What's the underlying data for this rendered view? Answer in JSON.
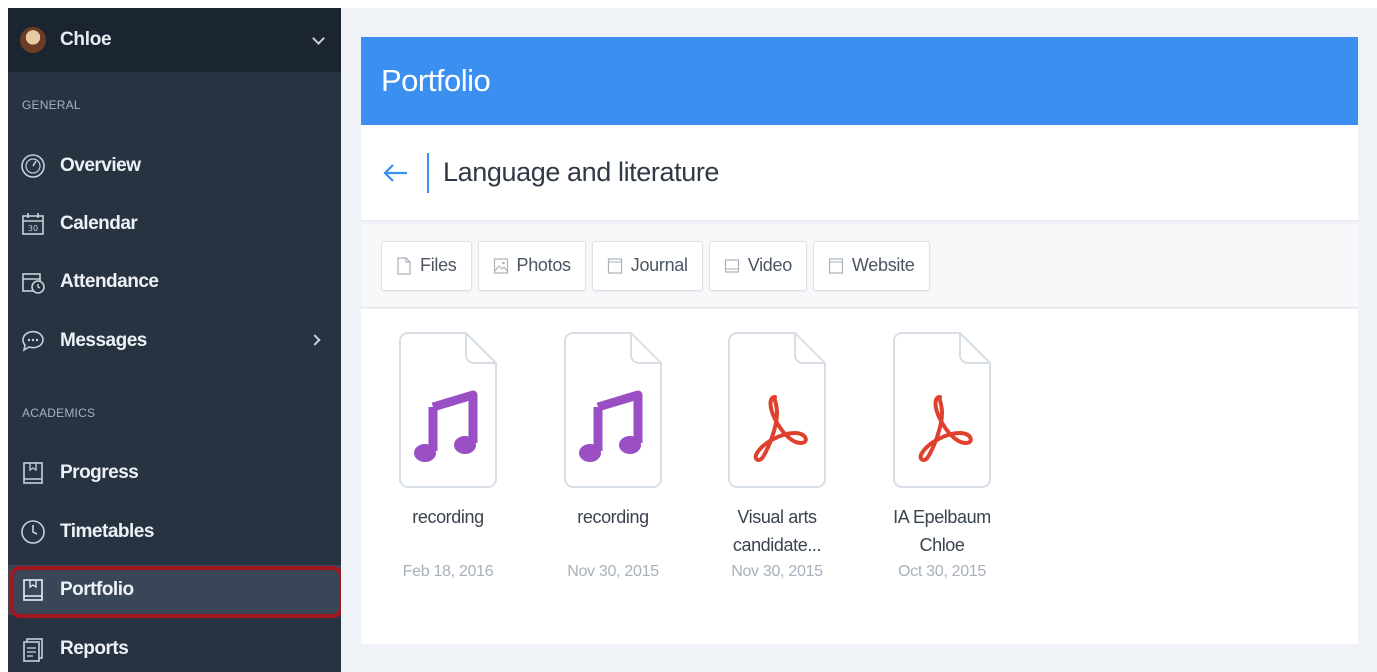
{
  "user": {
    "name": "Chloe"
  },
  "sidebar": {
    "sections": [
      "GENERAL",
      "ACADEMICS"
    ],
    "items": [
      {
        "label": "Overview",
        "icon": "overview-gauge-icon"
      },
      {
        "label": "Calendar",
        "icon": "calendar-icon",
        "badge": "30"
      },
      {
        "label": "Attendance",
        "icon": "attendance-calendar-clock-icon"
      },
      {
        "label": "Messages",
        "icon": "messages-bubble-icon",
        "has_arrow": true
      },
      {
        "label": "Progress",
        "icon": "progress-book-icon"
      },
      {
        "label": "Timetables",
        "icon": "clock-icon"
      },
      {
        "label": "Portfolio",
        "icon": "portfolio-book-icon",
        "active": true
      },
      {
        "label": "Reports",
        "icon": "reports-document-icon"
      }
    ]
  },
  "main": {
    "title": "Portfolio",
    "breadcrumb": "Language and literature",
    "tabs": [
      {
        "label": "Files",
        "icon": "file-icon"
      },
      {
        "label": "Photos",
        "icon": "photo-icon"
      },
      {
        "label": "Journal",
        "icon": "journal-icon"
      },
      {
        "label": "Video",
        "icon": "video-icon"
      },
      {
        "label": "Website",
        "icon": "website-icon"
      }
    ],
    "files": [
      {
        "name": "recording",
        "date": "Feb 18, 2016",
        "type": "audio"
      },
      {
        "name": "recording",
        "date": "Nov 30, 2015",
        "type": "audio"
      },
      {
        "name_line1": "Visual arts",
        "name_line2": "candidate...",
        "date": "Nov 30, 2015",
        "type": "pdf"
      },
      {
        "name_line1": "IA Epelbaum",
        "name_line2": "Chloe",
        "date": "Oct 30, 2015",
        "type": "pdf"
      }
    ]
  },
  "colors": {
    "sidebar_bg": "#283342",
    "header_blue": "#3b8ff1",
    "audio_purple": "#9b4fc4",
    "pdf_red": "#e0402e",
    "active_outline": "#a3151f"
  }
}
